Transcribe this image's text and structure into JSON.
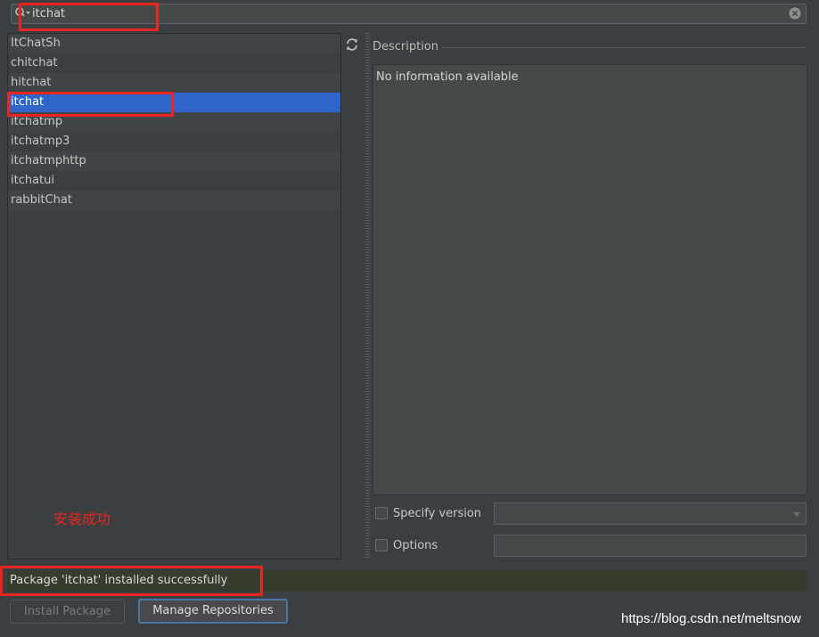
{
  "search": {
    "value": "itchat",
    "icon": "search-icon",
    "clear_icon": "clear-icon"
  },
  "packages": {
    "items": [
      "ItChatSh",
      "chitchat",
      "hitchat",
      "itchat",
      "itchatmp",
      "itchatmp3",
      "itchatmphttp",
      "itchatui",
      "rabbitChat"
    ],
    "selected": "itchat",
    "refresh_icon": "refresh-icon"
  },
  "description": {
    "title": "Description",
    "text": "No information available"
  },
  "options": {
    "specify_version_label": "Specify version",
    "version_value": "",
    "options_label": "Options",
    "options_value": ""
  },
  "annotation": "安装成功",
  "status": {
    "text": "Package 'itchat' installed successfully"
  },
  "buttons": {
    "install": "Install Package",
    "manage": "Manage Repositories"
  },
  "watermark": "https://blog.csdn.net/meltsnow",
  "colors": {
    "background": "#3c3f41",
    "selection": "#2f65ca",
    "status_bg": "#343d2e",
    "highlight": "#e8251f",
    "focus_border": "#4677a6"
  }
}
